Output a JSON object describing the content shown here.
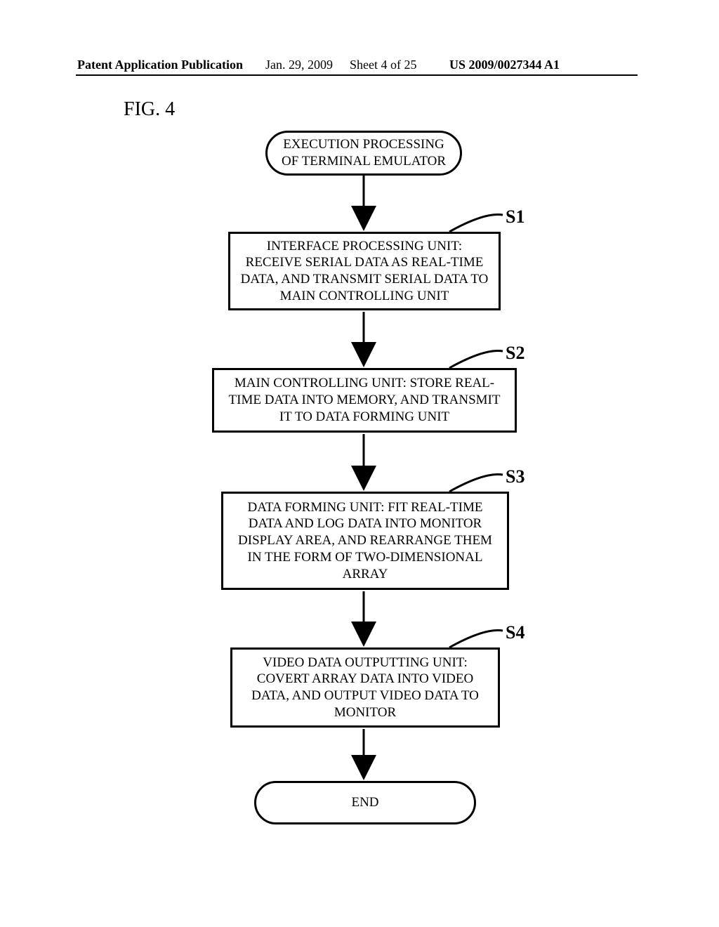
{
  "header": {
    "publication": "Patent Application Publication",
    "date": "Jan. 29, 2009",
    "sheet": "Sheet 4 of 25",
    "docnum": "US 2009/0027344 A1"
  },
  "figure_label": "FIG. 4",
  "flow": {
    "start": "EXECUTION PROCESSING OF TERMINAL EMULATOR",
    "s1": {
      "label": "S1",
      "text": "INTERFACE PROCESSING UNIT: RECEIVE SERIAL DATA AS REAL-TIME DATA, AND TRANSMIT SERIAL DATA TO MAIN CONTROLLING UNIT"
    },
    "s2": {
      "label": "S2",
      "text": "MAIN CONTROLLING UNIT: STORE REAL-TIME DATA INTO MEMORY, AND TRANSMIT IT TO DATA FORMING UNIT"
    },
    "s3": {
      "label": "S3",
      "text": "DATA FORMING UNIT: FIT REAL-TIME DATA AND LOG DATA INTO MONITOR DISPLAY AREA, AND REARRANGE THEM IN THE FORM OF TWO-DIMENSIONAL ARRAY"
    },
    "s4": {
      "label": "S4",
      "text": "VIDEO DATA OUTPUTTING UNIT: COVERT ARRAY DATA INTO VIDEO DATA, AND OUTPUT VIDEO DATA TO MONITOR"
    },
    "end": "END"
  }
}
